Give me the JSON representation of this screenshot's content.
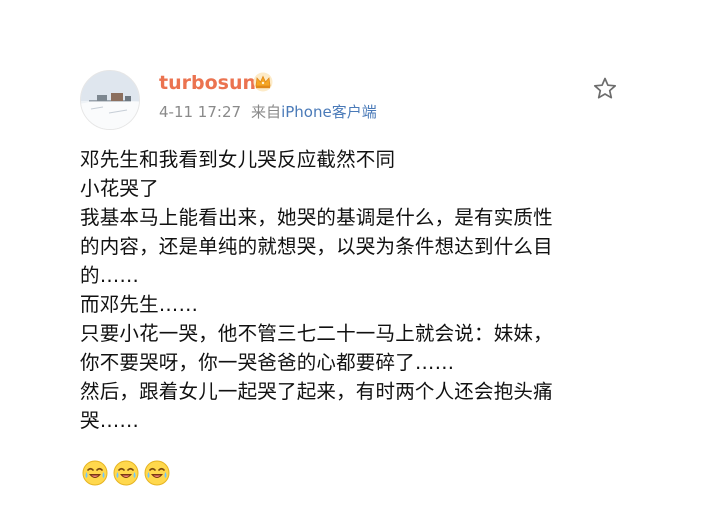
{
  "user": {
    "name": "turbosun",
    "badge_icon": "crown-icon",
    "badge_color": "#f5a623"
  },
  "meta": {
    "date_time": "4-11 17:27",
    "source_prefix": "来自",
    "source_device": "iPhone客户端"
  },
  "actions": {
    "favorite_icon": "star-outline-icon"
  },
  "post": {
    "lines": [
      "邓先生和我看到女儿哭反应截然不同",
      "小花哭了",
      "我基本马上能看出来，她哭的基调是什么，是有实质性",
      "的内容，还是单纯的就想哭，以哭为条件想达到什么目",
      "的……",
      "而邓先生……",
      "只要小花一哭，他不管三七二十一马上就会说：妹妹，",
      "你不要哭呀，你一哭爸爸的心都要碎了……",
      "然后，跟着女儿一起哭了起来，有时两个人还会抱头痛",
      "哭……"
    ],
    "emojis": [
      "crying-laughing-emoji",
      "crying-laughing-emoji",
      "crying-laughing-emoji"
    ]
  },
  "colors": {
    "username": "#eb7350",
    "device_link": "#4a7ab8",
    "meta_text": "#8a8a8a"
  }
}
